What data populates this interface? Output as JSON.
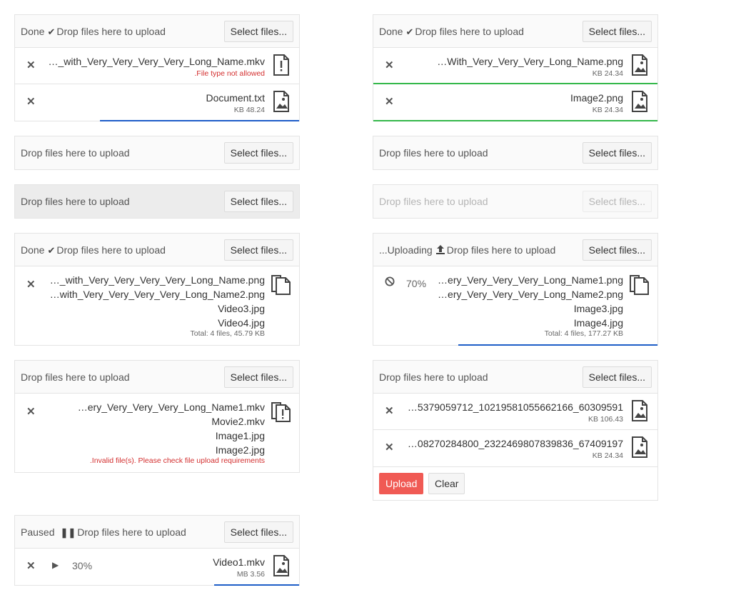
{
  "colors": {
    "progress_blue": "#1e5dc8",
    "success_green": "#35b84b",
    "error_red": "#d32f2f",
    "upload_button": "#f05a54"
  },
  "common": {
    "drop_text": "Drop files here to upload",
    "select_label": "Select files..."
  },
  "u1": {
    "status": "Done",
    "status_icon": "check-icon",
    "files": [
      {
        "name": "…_with_Very_Very_Very_Very_Long_Name.mkv",
        "meta": ".File type not allowed",
        "icon": "file-error-icon"
      },
      {
        "name": "Document.txt",
        "meta": "KB 48.24",
        "icon": "image-file-icon",
        "progress": 0.7
      }
    ]
  },
  "u2": {
    "status": "Done",
    "status_icon": "check-icon",
    "files": [
      {
        "name": "…With_Very_Very_Very_Long_Name.png",
        "meta": "KB 24.34",
        "icon": "image-file-icon",
        "progress": 1
      },
      {
        "name": "Image2.png",
        "meta": "KB 24.34",
        "icon": "image-file-icon",
        "progress": 1
      }
    ]
  },
  "u3": {},
  "u4": {},
  "u5": {
    "state": "hover"
  },
  "u6": {
    "state": "disabled"
  },
  "u7": {
    "status": "Done",
    "status_icon": "check-icon",
    "names": [
      "…_with_Very_Very_Very_Very_Long_Name.png",
      "…with_Very_Very_Very_Very_Long_Name2.png",
      "Video3.jpg",
      "Video4.jpg"
    ],
    "summary": "Total: 4 files, 45.79 KB",
    "icon": "files-icon"
  },
  "u8": {
    "status": "...Uploading",
    "status_icon": "upload-icon",
    "percent": "70%",
    "names": [
      "…ery_Very_Very_Very_Long_Name1.png",
      "…ery_Very_Very_Very_Long_Name2.png",
      "Image3.jpg",
      "Image4.jpg"
    ],
    "summary": "Total: 4 files, 177.27 KB",
    "icon": "files-icon",
    "progress": 0.7
  },
  "u9": {
    "names": [
      "…ery_Very_Very_Very_Long_Name1.mkv",
      "Movie2.mkv",
      "Image1.jpg",
      "Image2.jpg"
    ],
    "summary": ".Invalid file(s). Please check file upload requirements",
    "icon": "files-error-icon"
  },
  "u10": {
    "files": [
      {
        "name": "…5379059712_10219581055662166_60309591",
        "meta": "KB 106.43",
        "icon": "image-file-icon"
      },
      {
        "name": "…08270284800_2322469807839836_67409197",
        "meta": "KB 24.34",
        "icon": "image-file-icon"
      }
    ],
    "upload_label": "Upload",
    "clear_label": "Clear"
  },
  "u11": {
    "status": "Paused",
    "status_icon": "pause-icon",
    "percent": "30%",
    "files": [
      {
        "name": "Video1.mkv",
        "meta": "MB 3.56",
        "icon": "image-file-icon",
        "progress": 0.3
      }
    ]
  }
}
